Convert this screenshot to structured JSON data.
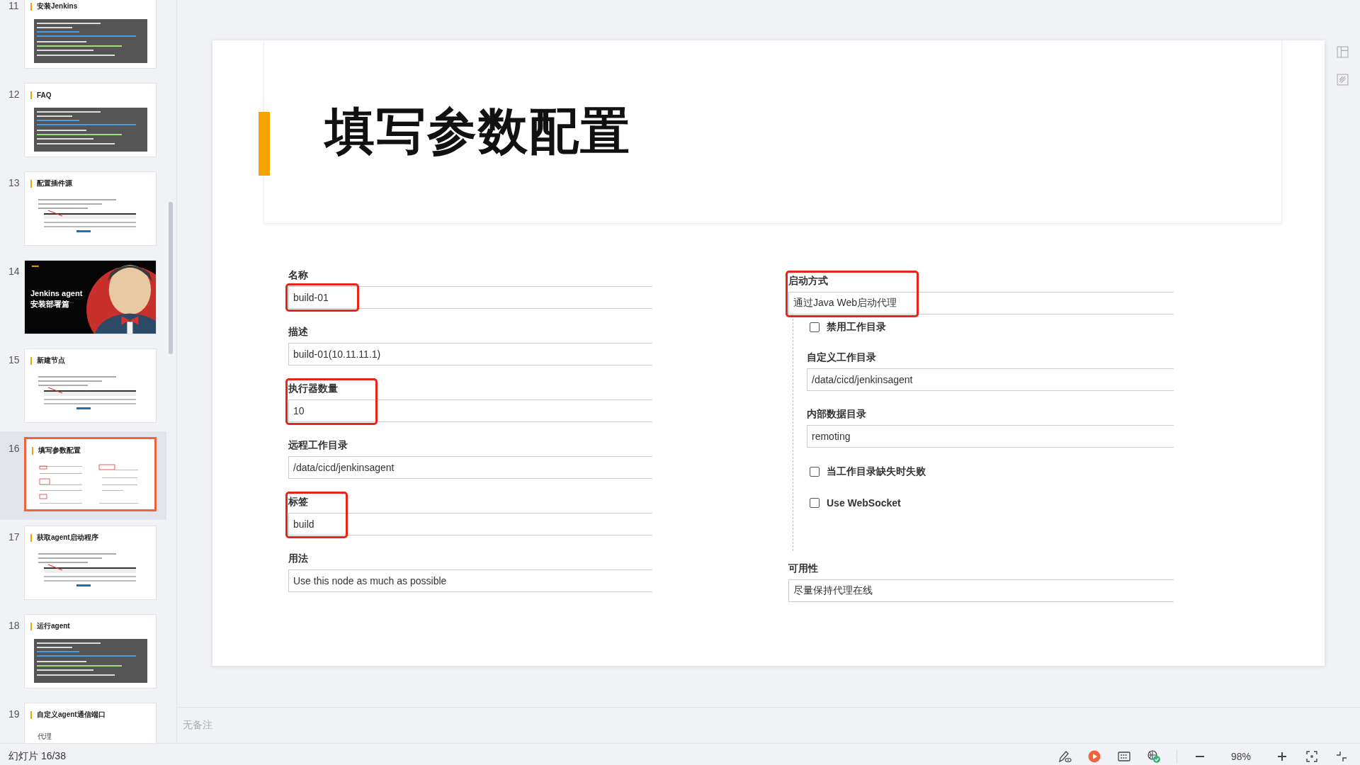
{
  "sidebar": {
    "slides": [
      {
        "number": "11",
        "title": "安装Jenkins",
        "kind": "code",
        "selected": false
      },
      {
        "number": "12",
        "title": "FAQ",
        "kind": "code",
        "selected": false
      },
      {
        "number": "13",
        "title": "配置插件源",
        "kind": "screenshot",
        "selected": false
      },
      {
        "number": "14",
        "title": "Jenkins agent",
        "subtitle": "安装部署篇",
        "kind": "cover",
        "selected": false
      },
      {
        "number": "15",
        "title": "新建节点",
        "kind": "screenshot",
        "selected": false
      },
      {
        "number": "16",
        "title": "填写参数配置",
        "kind": "form",
        "selected": true
      },
      {
        "number": "17",
        "title": "获取agent启动程序",
        "kind": "screenshot",
        "selected": false
      },
      {
        "number": "18",
        "title": "运行agent",
        "kind": "code",
        "selected": false
      },
      {
        "number": "19",
        "title": "自定义agent通信端口",
        "kind": "text",
        "body": "代理",
        "selected": false
      }
    ]
  },
  "slide": {
    "title": "填写参数配置",
    "left_fields": [
      {
        "label": "名称",
        "value": "build-01",
        "highlight": {
          "kind": "field"
        }
      },
      {
        "label": "描述",
        "value": "build-01(10.11.11.1)"
      },
      {
        "label": "执行器数量",
        "value": "10",
        "highlight": {
          "kind": "label_and_field"
        }
      },
      {
        "label": "远程工作目录",
        "value": "/data/cicd/jenkinsagent"
      },
      {
        "label": "标签",
        "value": "build",
        "highlight": {
          "kind": "label_and_field"
        }
      },
      {
        "label": "用法",
        "value": "Use this node as much as possible"
      }
    ],
    "right_fields": [
      {
        "label": "启动方式",
        "value": "通过Java Web启动代理",
        "highlight": {
          "kind": "label_and_field"
        },
        "children": [
          {
            "kind": "checkbox",
            "label": "禁用工作目录",
            "checked": false
          },
          {
            "kind": "field",
            "label": "自定义工作目录",
            "value": "/data/cicd/jenkinsagent"
          },
          {
            "kind": "field",
            "label": "内部数据目录",
            "value": "remoting"
          },
          {
            "kind": "checkbox",
            "label": "当工作目录缺失时失败",
            "checked": false
          },
          {
            "kind": "checkbox",
            "label": "Use WebSocket",
            "checked": false
          }
        ]
      },
      {
        "label": "可用性",
        "value": "尽量保持代理在线"
      }
    ]
  },
  "notes": {
    "placeholder": "无备注"
  },
  "status_bar": {
    "slide_counter": "幻灯片 16/38",
    "zoom": "98%"
  }
}
